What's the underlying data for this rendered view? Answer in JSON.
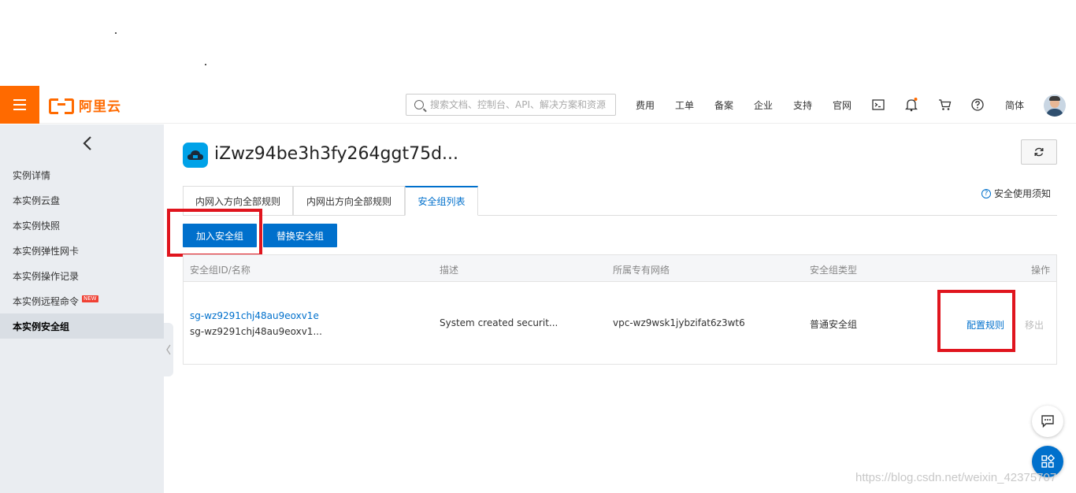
{
  "header": {
    "logo_text": "阿里云",
    "search_placeholder": "搜索文档、控制台、API、解决方案和资源",
    "nav": [
      "费用",
      "工单",
      "备案",
      "企业",
      "支持",
      "官网"
    ],
    "language": "简体",
    "icons": [
      "terminal-icon",
      "bell-icon",
      "cart-icon",
      "help-icon"
    ],
    "accent_color": "#ff6a00"
  },
  "sidebar": {
    "items": [
      {
        "label": "实例详情"
      },
      {
        "label": "本实例云盘"
      },
      {
        "label": "本实例快照"
      },
      {
        "label": "本实例弹性网卡"
      },
      {
        "label": "本实例操作记录"
      },
      {
        "label": "本实例远程命令",
        "badge": "NEW"
      },
      {
        "label": "本实例安全组",
        "active": true
      }
    ]
  },
  "main": {
    "instance_name": "iZwz94be3h3fy264ggt75d...",
    "tabs": [
      {
        "label": "内网入方向全部规则"
      },
      {
        "label": "内网出方向全部规则"
      },
      {
        "label": "安全组列表",
        "active": true
      }
    ],
    "tip_link": "安全使用须知",
    "buttons": {
      "join": "加入安全组",
      "replace": "替换安全组"
    },
    "table": {
      "headers": [
        "安全组ID/名称",
        "描述",
        "所属专有网络",
        "安全组类型",
        "操作"
      ],
      "rows": [
        {
          "id": "sg-wz9291chj48au9eoxv1e",
          "name": "sg-wz9291chj48au9eoxv1...",
          "description": "System created securit...",
          "vpc": "vpc-wz9wsk1jybzifat6z3wt6",
          "type": "普通安全组",
          "action_config": "配置规则",
          "action_remove": "移出"
        }
      ]
    }
  },
  "watermark": "https://blog.csdn.net/weixin_42375707",
  "colors": {
    "primary": "#0070cc",
    "highlight": "#e0151e",
    "sidebar_bg": "#eaedf1"
  }
}
